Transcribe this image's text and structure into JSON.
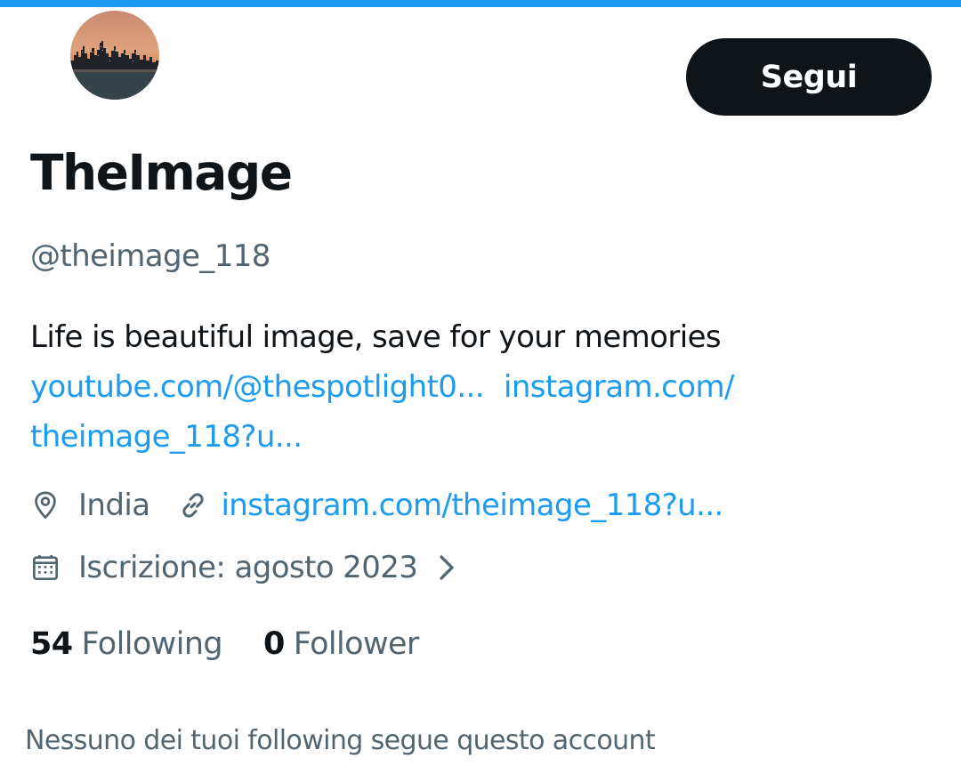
{
  "colors": {
    "accent": "#1d9bf0",
    "text_primary": "#0f1419",
    "text_secondary": "#536471",
    "button_bg": "#0f1419",
    "button_text": "#ffffff"
  },
  "profile": {
    "display_name": "TheImage",
    "handle": "@theimage_118",
    "follow_button_label": "Segui",
    "bio_text": "Life is beautiful image, save for your memories",
    "bio_links": {
      "youtube": "youtube.com/@thespotlight0...",
      "instagram_part1": "instagram.com/",
      "instagram_part2": "theimage_118?u..."
    },
    "avatar_icon": "city-skyline-avatar"
  },
  "meta": {
    "location_icon": "location-pin-icon",
    "location": "India",
    "website_icon": "link-icon",
    "website": "instagram.com/theimage_118?u...",
    "joined_icon": "calendar-icon",
    "joined": "Iscrizione: agosto 2023",
    "chevron_icon": "chevron-right-icon"
  },
  "stats": {
    "following_count": "54",
    "following_label": "Following",
    "followers_count": "0",
    "followers_label": "Follower"
  },
  "mutuals_text": "Nessuno dei tuoi following segue questo account"
}
